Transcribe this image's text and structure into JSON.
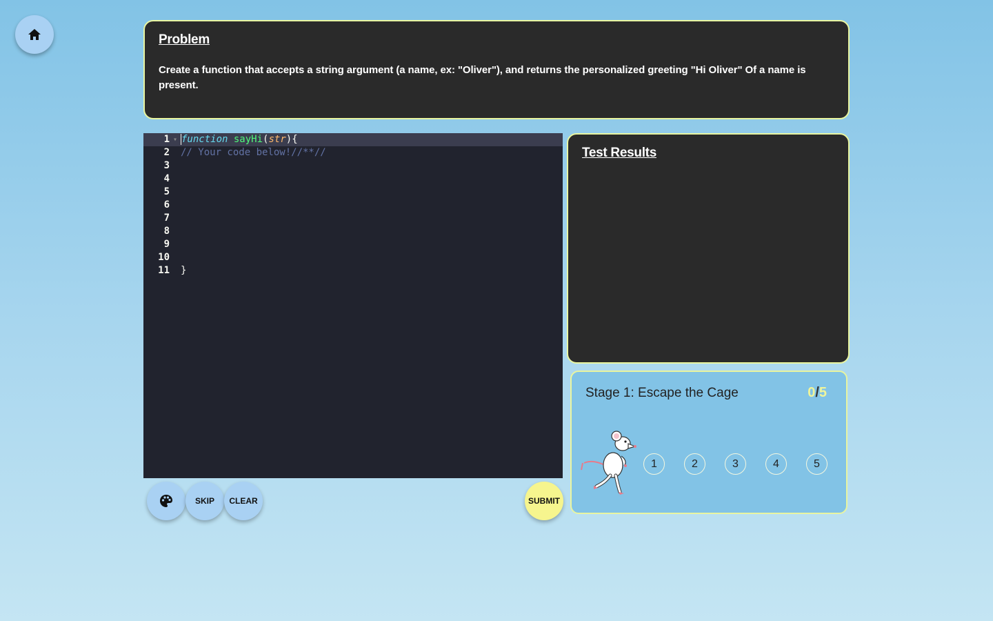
{
  "problem": {
    "title": "Problem",
    "text": "Create a function that accepts a string argument (a name, ex: \"Oliver\"), and returns the personalized greeting \"Hi Oliver\" Of a name is present."
  },
  "editor": {
    "line_numbers": [
      "1",
      "2",
      "3",
      "4",
      "5",
      "6",
      "7",
      "8",
      "9",
      "10",
      "11"
    ],
    "code": {
      "line1_keyword": "function",
      "line1_name": "sayHi",
      "line1_open": "(",
      "line1_param": "str",
      "line1_close": "){",
      "line2_comment": "// Your code below!//**//",
      "line11": "}"
    }
  },
  "controls": {
    "palette_icon": "palette-icon",
    "skip_label": "SKIP",
    "clear_label": "CLEAR",
    "submit_label": "SUBMIT"
  },
  "home": {
    "icon": "home-icon"
  },
  "results": {
    "title": "Test Results"
  },
  "stage": {
    "title": "Stage 1: Escape the Cage",
    "score": "0",
    "separator": "/",
    "total": "5",
    "steps": [
      "1",
      "2",
      "3",
      "4",
      "5"
    ]
  },
  "colors": {
    "panel_bg": "#2a2a2a",
    "panel_border": "#e9f5a0",
    "button_blue": "#a9d1f3",
    "submit_yellow": "#f6f58e",
    "editor_bg": "#21232e"
  }
}
